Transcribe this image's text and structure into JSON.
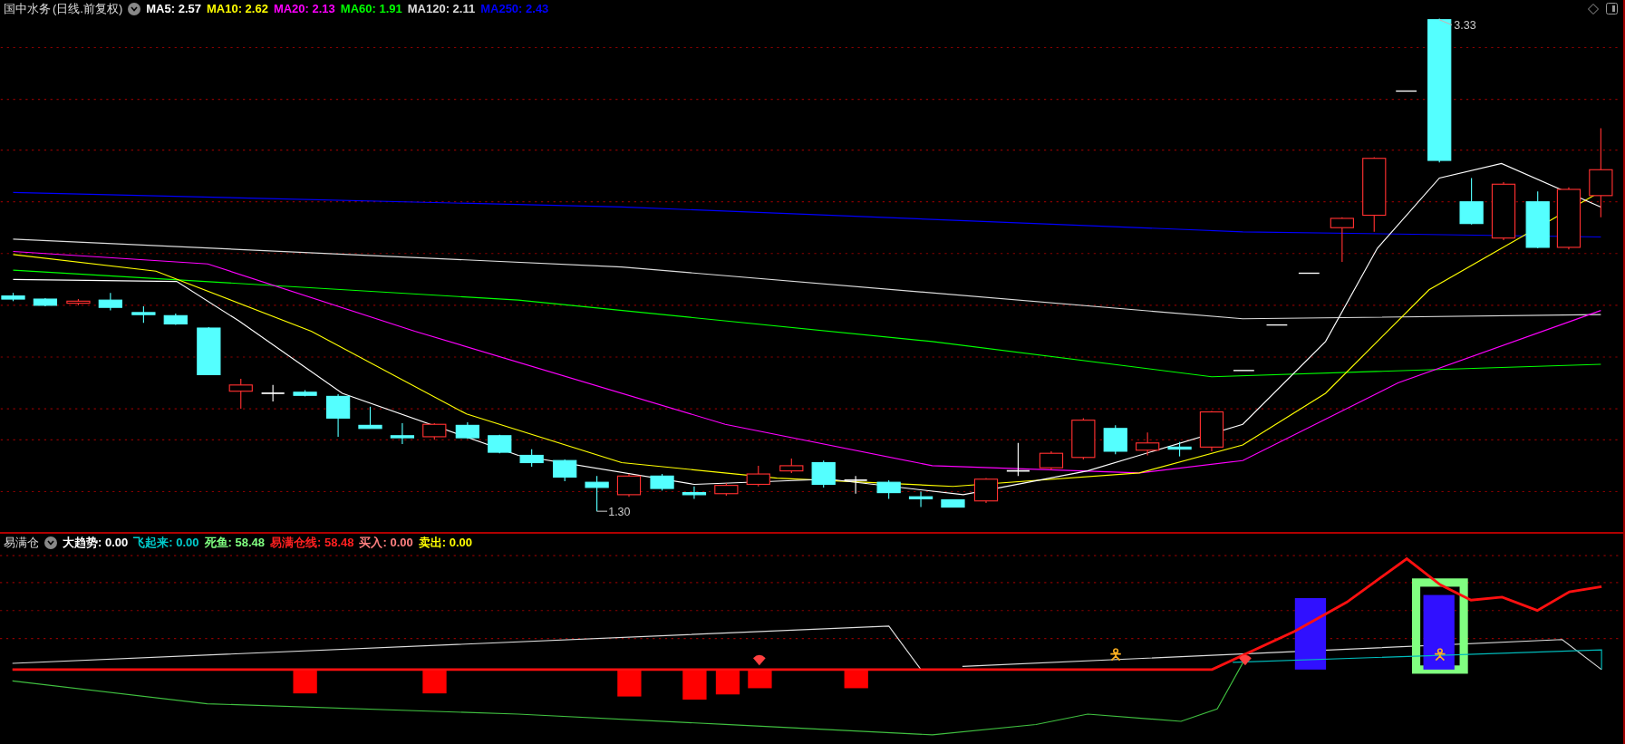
{
  "main_chart": {
    "title": "国中水务",
    "mode": "(日线.前复权)",
    "indicators": [
      {
        "label": "MA5: 2.57",
        "color": "#ffffff"
      },
      {
        "label": "MA10: 2.62",
        "color": "#ffff00"
      },
      {
        "label": "MA20: 2.13",
        "color": "#ff00ff"
      },
      {
        "label": "MA60: 1.91",
        "color": "#00ff00"
      },
      {
        "label": "MA120: 2.11",
        "color": "#dddddd"
      },
      {
        "label": "MA250: 2.43",
        "color": "#0000ff"
      }
    ],
    "high_label": "3.33",
    "low_label": "1.30"
  },
  "sub_chart": {
    "title": "易满仓",
    "indicators": [
      {
        "label": "大趋势: 0.00",
        "color": "#ffffff"
      },
      {
        "label": "飞起来: 0.00",
        "color": "#00cccc"
      },
      {
        "label": "死鱼: 58.48",
        "color": "#80ff80"
      },
      {
        "label": "易满仓线: 58.48",
        "color": "#ff2020"
      },
      {
        "label": "买入: 0.00",
        "color": "#ff8080"
      },
      {
        "label": "卖出: 0.00",
        "color": "#ffff00"
      }
    ]
  }
}
